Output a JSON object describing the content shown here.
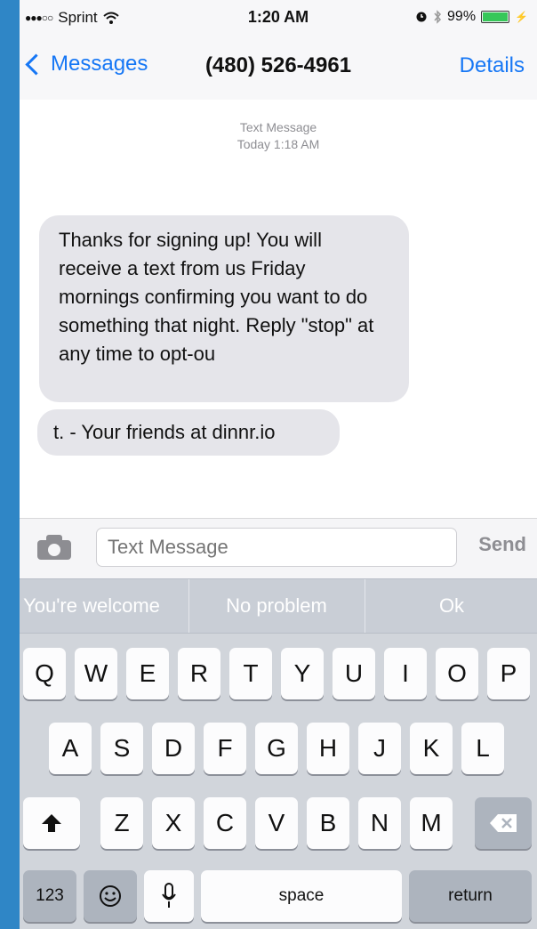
{
  "status_bar": {
    "carrier": "Sprint",
    "time": "1:20 AM",
    "battery": "99%",
    "battery_level": 0.99
  },
  "nav": {
    "back_label": "Messages",
    "title": "(480) 526-4961",
    "details_label": "Details"
  },
  "thread": {
    "meta_type": "Text Message",
    "meta_time": "Today 1:18 AM",
    "messages": [
      "Thanks for signing up! You will receive a text from us Friday mornings confirming you want to do something that night. Reply \"stop\" at any time to opt-ou",
      "t. - Your friends at dinnr.io"
    ]
  },
  "compose": {
    "placeholder": "Text Message",
    "send_label": "Send"
  },
  "quick_replies": [
    "You're welcome",
    "No problem",
    "Ok"
  ],
  "keyboard": {
    "row1": [
      "Q",
      "W",
      "E",
      "R",
      "T",
      "Y",
      "U",
      "I",
      "O",
      "P"
    ],
    "row2": [
      "A",
      "S",
      "D",
      "F",
      "G",
      "H",
      "J",
      "K",
      "L"
    ],
    "row3": [
      "Z",
      "X",
      "C",
      "V",
      "B",
      "N",
      "M"
    ],
    "numbers_label": "123",
    "space_label": "space",
    "return_label": "return"
  },
  "colors": {
    "accent": "#1677f5",
    "bubble_received": "#e5e5ea",
    "keyboard_bg": "#d1d5db"
  }
}
